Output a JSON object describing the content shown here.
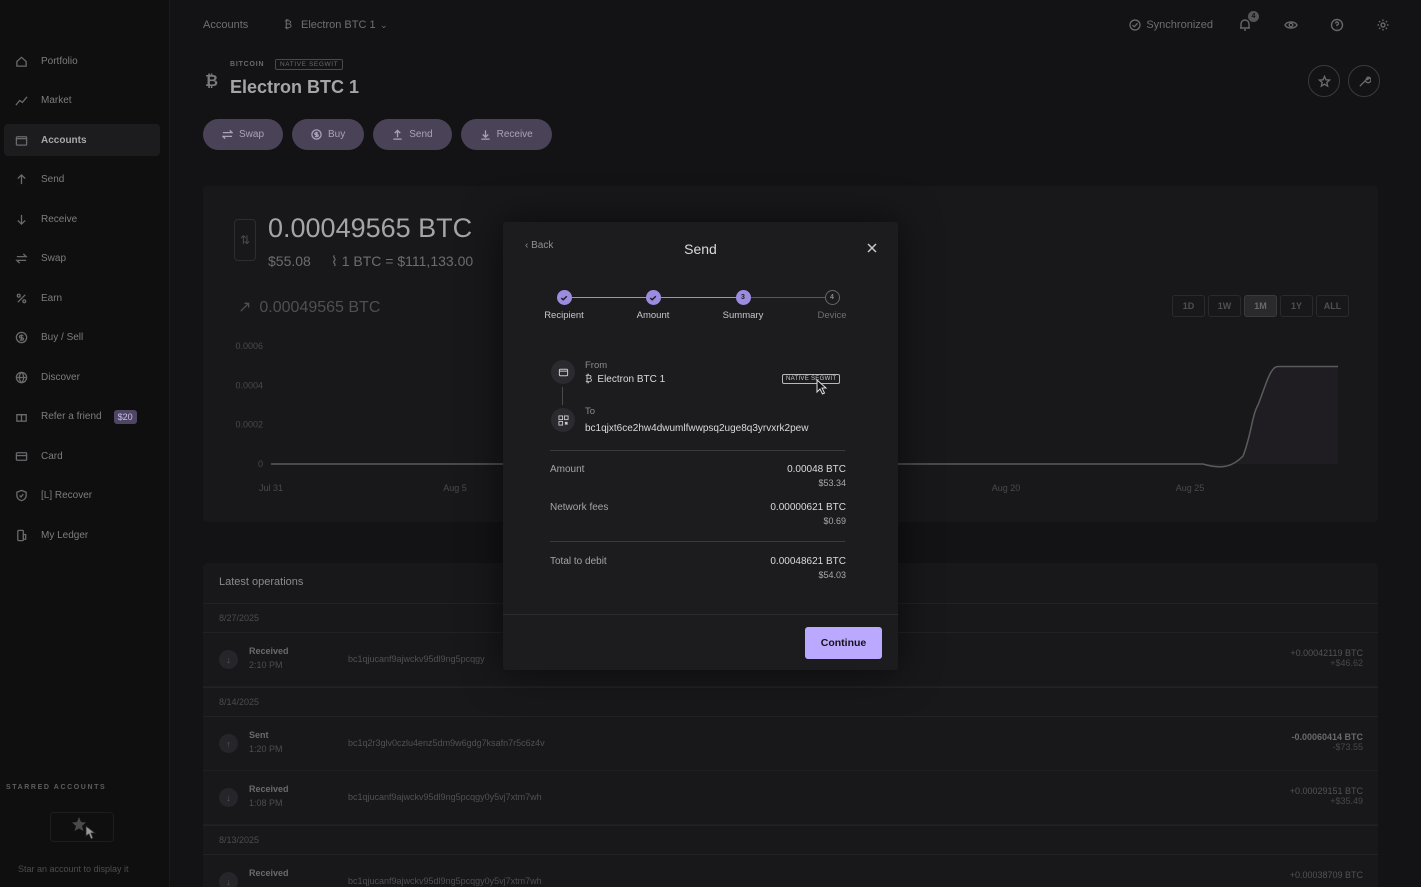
{
  "sidebar": {
    "items": [
      {
        "label": "Portfolio",
        "icon": "home-icon"
      },
      {
        "label": "Market",
        "icon": "chart-icon"
      },
      {
        "label": "Accounts",
        "icon": "wallet-icon"
      },
      {
        "label": "Send",
        "icon": "arrow-up-icon"
      },
      {
        "label": "Receive",
        "icon": "arrow-down-icon"
      },
      {
        "label": "Swap",
        "icon": "swap-icon"
      },
      {
        "label": "Earn",
        "icon": "percent-icon"
      },
      {
        "label": "Buy / Sell",
        "icon": "dollar-icon"
      },
      {
        "label": "Discover",
        "icon": "globe-icon"
      },
      {
        "label": "Refer a friend",
        "icon": "gift-icon",
        "badge": "$20"
      },
      {
        "label": "Card",
        "icon": "card-icon"
      },
      {
        "label": "[L] Recover",
        "icon": "shield-icon"
      },
      {
        "label": "My Ledger",
        "icon": "device-icon"
      }
    ],
    "active": "Accounts",
    "starred_title": "STARRED ACCOUNTS",
    "starred_hint": "Star an account to display it"
  },
  "topbar": {
    "breadcrumb_root": "Accounts",
    "breadcrumb_account": "Electron BTC 1",
    "sync_label": "Synchronized",
    "notif_count": "4"
  },
  "account": {
    "coin": "BITCOIN",
    "segwit_tag": "NATIVE SEGWIT",
    "name": "Electron BTC 1",
    "actions": {
      "swap": "Swap",
      "buy": "Buy",
      "send": "Send",
      "receive": "Receive"
    }
  },
  "balance": {
    "crypto": "0.00049565 BTC",
    "fiat": "$55.08",
    "rate": "1 BTC = $111,133.00",
    "chart_value": "0.00049565 BTC",
    "ranges": [
      "1D",
      "1W",
      "1M",
      "1Y",
      "ALL"
    ],
    "active_range": "1M"
  },
  "chart_data": {
    "type": "area",
    "y_ticks": [
      "0.0006",
      "0.0004",
      "0.0002",
      "0"
    ],
    "x_ticks": [
      "Jul 31",
      "Aug 5",
      "Aug 20",
      "Aug 25"
    ],
    "ylim": [
      0,
      0.0006
    ],
    "series": [
      {
        "x": [
          "Jul 31",
          "Aug 24",
          "Aug 25",
          "Aug 26",
          "Aug 27",
          "Aug 30"
        ],
        "values": [
          0,
          0,
          4e-05,
          0.0003,
          0.0004956,
          0.0004956
        ]
      }
    ]
  },
  "operations": {
    "title": "Latest operations",
    "groups": [
      {
        "date": "8/27/2025",
        "rows": [
          {
            "type": "Received",
            "time": "2:10 PM",
            "address": "bc1qjucanf9ajwckv95dl9ng5pcqgy",
            "amount": "+0.00042119 BTC",
            "fiat": "+$46.62"
          }
        ]
      },
      {
        "date": "8/14/2025",
        "rows": [
          {
            "type": "Sent",
            "time": "1:20 PM",
            "address": "bc1q2r3glv0czlu4enz5dm9w6gdg7ksafn7r5c6z4v",
            "amount": "-0.00060414 BTC",
            "fiat": "-$73.55"
          },
          {
            "type": "Received",
            "time": "1:08 PM",
            "address": "bc1qjucanf9ajwckv95dl9ng5pcqgy0y5vj7xtm7wh",
            "amount": "+0.00029151 BTC",
            "fiat": "+$35.49"
          }
        ]
      },
      {
        "date": "8/13/2025",
        "rows": [
          {
            "type": "Received",
            "time": "",
            "address": "bc1qjucanf9ajwckv95dl9ng5pcqgy0y5vj7xtm7wh",
            "amount": "+0.00038709 BTC",
            "fiat": ""
          }
        ]
      }
    ]
  },
  "modal": {
    "back": "Back",
    "title": "Send",
    "steps": [
      {
        "label": "Recipient",
        "state": "done",
        "num": "1"
      },
      {
        "label": "Amount",
        "state": "done",
        "num": "2"
      },
      {
        "label": "Summary",
        "state": "current",
        "num": "3"
      },
      {
        "label": "Device",
        "state": "todo",
        "num": "4"
      }
    ],
    "from_label": "From",
    "from_account": "Electron BTC 1",
    "from_tag": "NATIVE SEGWIT",
    "to_label": "To",
    "to_address": "bc1qjxt6ce2hw4dwumlfwwpsq2uge8q3yrvxrk2pew",
    "amount_label": "Amount",
    "amount_crypto": "0.00048 BTC",
    "amount_fiat": "$53.34",
    "fees_label": "Network fees",
    "fees_crypto": "0.00000621 BTC",
    "fees_fiat": "$0.69",
    "total_label": "Total to debit",
    "total_crypto": "0.00048621 BTC",
    "total_fiat": "$54.03",
    "continue": "Continue"
  }
}
